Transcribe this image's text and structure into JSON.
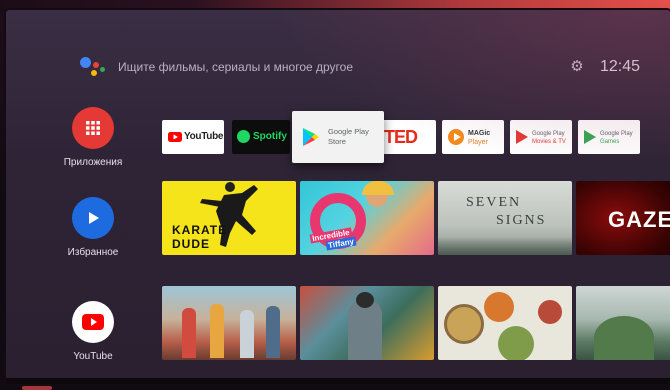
{
  "topbar": {
    "search_placeholder": "Ищите фильмы, сериалы и многое другое",
    "time": "12:45"
  },
  "sidebar": {
    "items": [
      {
        "label": "Приложения",
        "icon": "apps-grid-icon"
      },
      {
        "label": "Избранное",
        "icon": "play-icon"
      },
      {
        "label": "YouTube",
        "icon": "youtube-icon"
      }
    ]
  },
  "apps": {
    "youtube": "YouTube",
    "spotify": "Spotify",
    "play_store_line1": "Google Play",
    "play_store_line2": "Store",
    "ted": "TED",
    "magic_line1": "MAGic",
    "magic_line2": "Player",
    "play_movies_line1": "Google Play",
    "play_movies_line2": "Movies & TV",
    "play_games_line1": "Google Play",
    "play_games_line2": "Games"
  },
  "tiles": {
    "karate_line1": "KARATE",
    "karate_line2": "DUDE",
    "tiffany_line1": "Incredible",
    "tiffany_line2": "Tiffany",
    "seven_line1": "SEVEN",
    "seven_line2": "SIGNS",
    "gaze": "GAZE"
  },
  "colors": {
    "accent_red": "#e53935",
    "accent_blue": "#1e6be0"
  }
}
